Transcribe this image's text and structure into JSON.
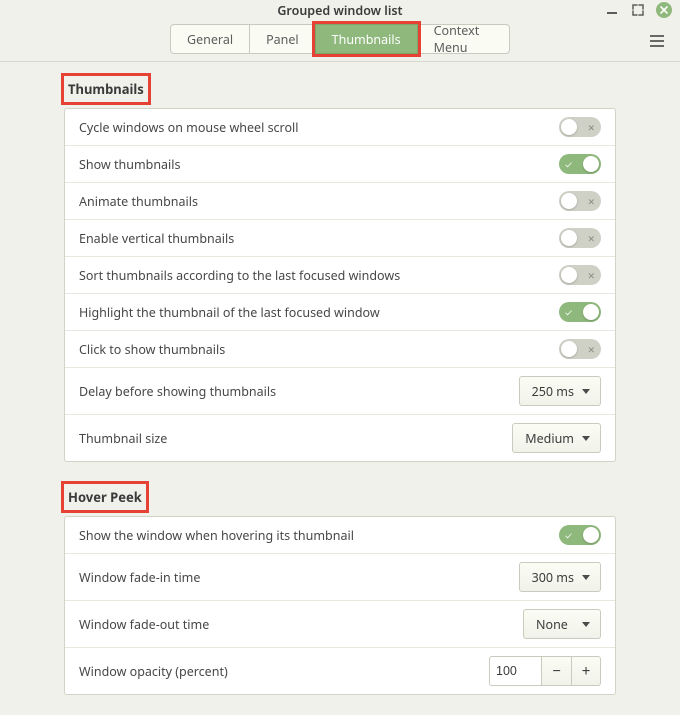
{
  "window": {
    "title": "Grouped window list"
  },
  "tabs": {
    "general": "General",
    "panel": "Panel",
    "thumbnails": "Thumbnails",
    "context": "Context Menu",
    "active": "thumbnails"
  },
  "section_thumbnails": {
    "heading": "Thumbnails",
    "rows": {
      "cycle": {
        "label": "Cycle windows on mouse wheel scroll",
        "on": false
      },
      "show": {
        "label": "Show thumbnails",
        "on": true
      },
      "animate": {
        "label": "Animate thumbnails",
        "on": false
      },
      "vertical": {
        "label": "Enable vertical thumbnails",
        "on": false
      },
      "sort": {
        "label": "Sort thumbnails according to the last focused windows",
        "on": false
      },
      "highlight": {
        "label": "Highlight the thumbnail of the last focused window",
        "on": true
      },
      "click": {
        "label": "Click to show thumbnails",
        "on": false
      },
      "delay": {
        "label": "Delay before showing thumbnails",
        "value": "250 ms"
      },
      "size": {
        "label": "Thumbnail size",
        "value": "Medium"
      }
    }
  },
  "section_hover": {
    "heading": "Hover Peek",
    "rows": {
      "show": {
        "label": "Show the window when hovering its thumbnail",
        "on": true
      },
      "fadein": {
        "label": "Window fade-in time",
        "value": "300 ms"
      },
      "fadeout": {
        "label": "Window fade-out time",
        "value": "None"
      },
      "opacity": {
        "label": "Window opacity (percent)",
        "value": "100"
      }
    }
  },
  "colors": {
    "accent": "#8fb97c",
    "highlight_border": "#e54134"
  }
}
